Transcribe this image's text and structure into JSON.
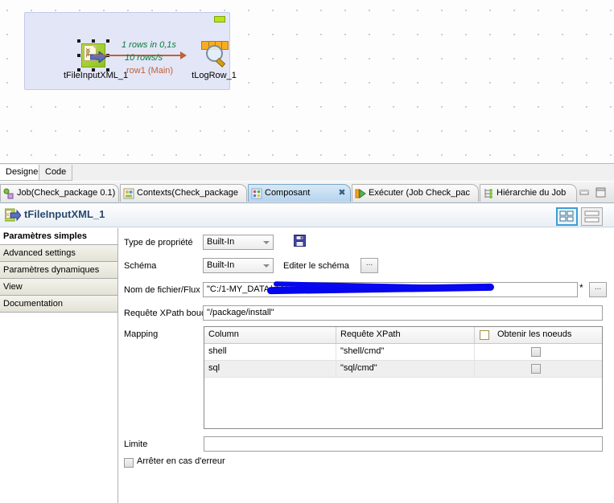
{
  "designer": {
    "subjob": {
      "collapse_toggle": "collapse",
      "nodes": [
        {
          "label": "tFileInputXML_1",
          "icon": "xml-input-icon",
          "selected": true
        },
        {
          "label": "tLogRow_1",
          "icon": "log-row-icon",
          "selected": false
        }
      ],
      "link": {
        "stat_rows": "1 rows in 0,1s",
        "stat_rate": "10 rows/s",
        "name": "row1 (Main)"
      }
    }
  },
  "editor_tabs": {
    "items": [
      {
        "label": "Designer",
        "active": true
      },
      {
        "label": "Code",
        "active": false
      }
    ]
  },
  "view_tabs": {
    "items": [
      {
        "label": "Job(Check_package 0.1)",
        "icon": "job-icon",
        "active": false,
        "closable": false
      },
      {
        "label": "Contexts(Check_package",
        "icon": "contexts-icon",
        "active": false,
        "closable": false
      },
      {
        "label": "Composant",
        "icon": "component-icon",
        "active": true,
        "closable": true,
        "close_glyph": "✖"
      },
      {
        "label": "Exécuter (Job Check_pac",
        "icon": "run-icon",
        "active": false,
        "closable": false
      },
      {
        "label": "Hiérarchie du Job",
        "icon": "hierarchy-icon",
        "active": false,
        "closable": false
      }
    ],
    "window_buttons": [
      {
        "name": "minimize",
        "glyph": "–"
      },
      {
        "name": "maximize",
        "glyph": "❐"
      }
    ]
  },
  "component": {
    "title": "tFileInputXML_1",
    "icon": "xml-input-icon",
    "view_toggle": [
      {
        "name": "grid-view",
        "active": true
      },
      {
        "name": "list-view",
        "active": false
      }
    ]
  },
  "side_tabs": {
    "items": [
      {
        "label": "Paramètres simples",
        "active": true
      },
      {
        "label": "Advanced settings",
        "active": false
      },
      {
        "label": "Paramètres dynamiques",
        "active": false
      },
      {
        "label": "View",
        "active": false
      },
      {
        "label": "Documentation",
        "active": false
      }
    ]
  },
  "form": {
    "property_type": {
      "label": "Type de propriété",
      "value": "Built-In",
      "save_icon": "floppy-save-icon"
    },
    "schema": {
      "label": "Schéma",
      "value": "Built-In",
      "edit_label": "Editer le schéma",
      "edit_button": "..."
    },
    "filename": {
      "label": "Nom de fichier/Flux",
      "value": "\"C:/1-MY_DATA/                                   TALEND/INPUT/test",
      "value_prefix": "\"C:/1-MY_DATA/",
      "value_suffix": "TALEND/INPUT/test",
      "redacted": true,
      "modified_marker": "*",
      "browse_button": "..."
    },
    "xpath_loop": {
      "label": "Requête XPath boucle",
      "value": "\"/package/install\""
    },
    "mapping": {
      "label": "Mapping",
      "columns": [
        "Column",
        "Requête XPath",
        "Obtenir les noeuds"
      ],
      "header_checkbox_checked": false,
      "rows": [
        {
          "column": "shell",
          "xpath": "\"shell/cmd\"",
          "get_nodes": false
        },
        {
          "column": "sql",
          "xpath": "\"sql/cmd\"",
          "get_nodes": false
        }
      ]
    },
    "limite": {
      "label": "Limite",
      "value": ""
    },
    "die_on_error": {
      "label": "Arrêter en cas d'erreur",
      "checked": false
    }
  },
  "colors": {
    "accent_blue": "#2b4a6f",
    "link_orange": "#c0603a",
    "stat_green": "#0b7a3e",
    "subjob_bg": "#e3e6f6",
    "redaction": "#0505ee"
  }
}
